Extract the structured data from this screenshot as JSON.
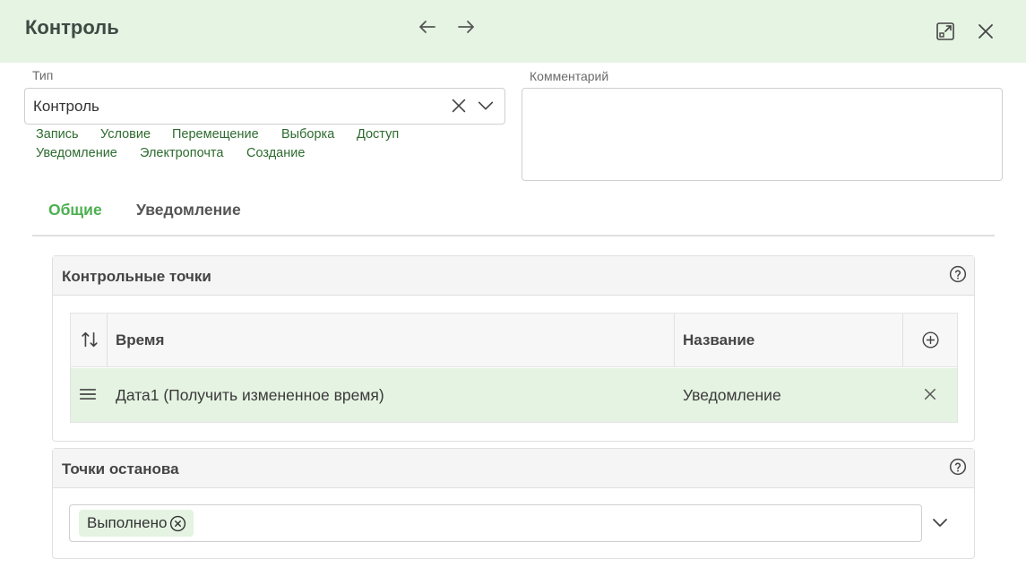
{
  "header": {
    "title": "Контроль",
    "icons": [
      "arrow-left-icon",
      "arrow-right-icon",
      "expand-icon",
      "close-icon"
    ]
  },
  "type_field": {
    "label": "Тип",
    "value": "Контроль"
  },
  "quick_links": [
    "Запись",
    "Условие",
    "Перемещение",
    "Выборка",
    "Доступ",
    "Уведомление",
    "Электропочта",
    "Создание"
  ],
  "comment_field": {
    "label": "Комментарий",
    "value": ""
  },
  "tabs": [
    {
      "label": "Общие",
      "active": true
    },
    {
      "label": "Уведомление",
      "active": false
    }
  ],
  "checkpoints": {
    "title": "Контрольные точки",
    "columns": [
      "Время",
      "Название"
    ],
    "rows": [
      {
        "time": "Дата1 (Получить измененное время)",
        "name": "Уведомление"
      }
    ]
  },
  "breakpoints": {
    "title": "Точки останова",
    "chips": [
      "Выполнено"
    ]
  },
  "colors": {
    "header_bg": "#e6f4e4",
    "accent": "#4caf50",
    "link": "#2e6b2f",
    "row_highlight": "#e5f3e2"
  }
}
